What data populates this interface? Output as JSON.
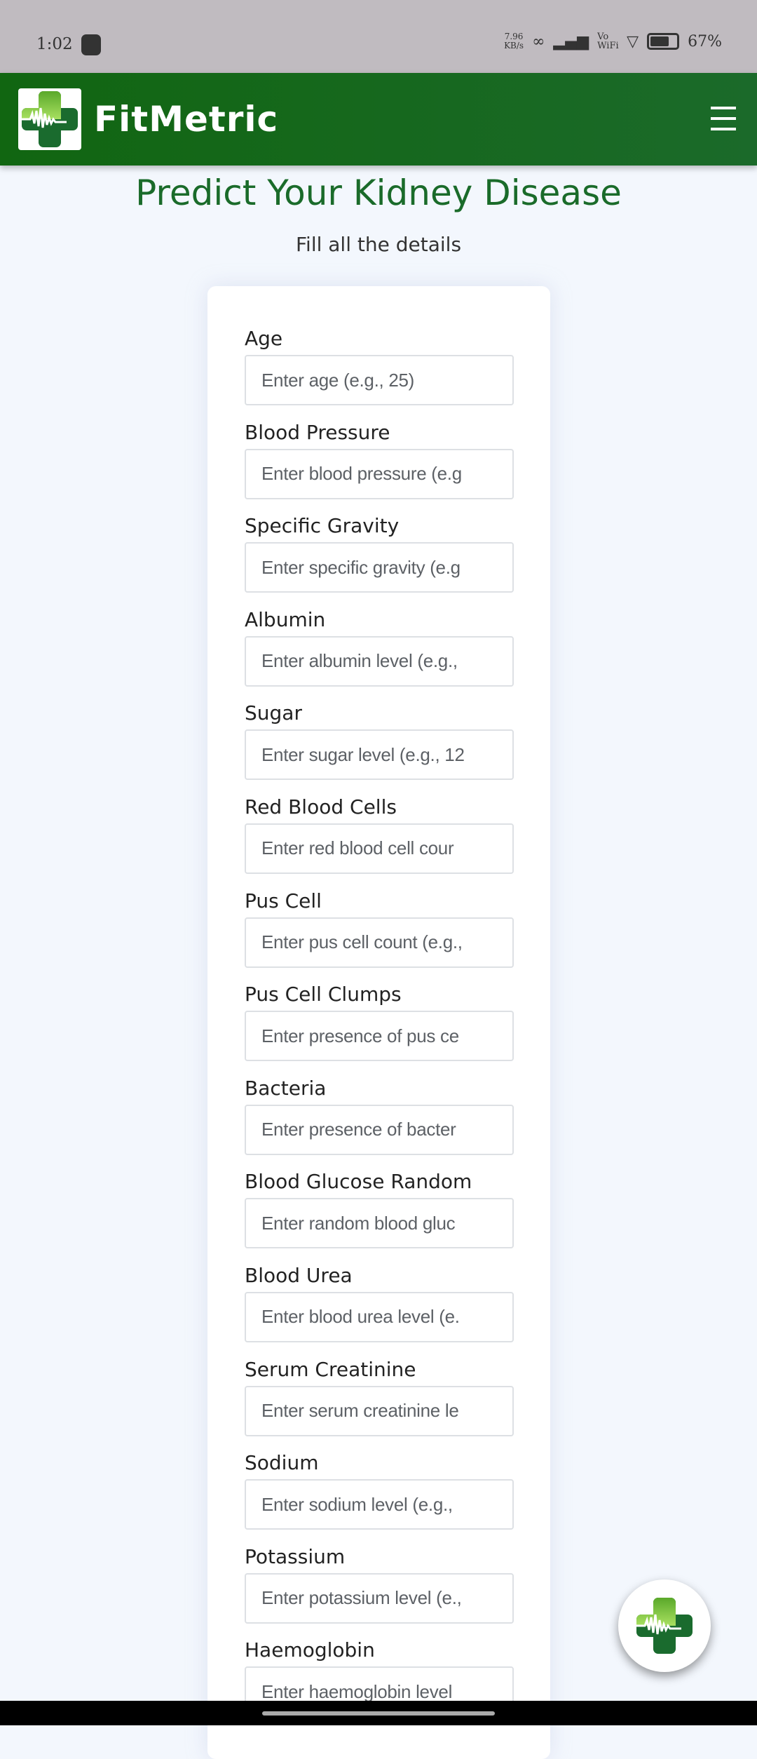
{
  "status_bar": {
    "time": "1:02",
    "net_speed": "7.96",
    "net_unit": "KB/s",
    "volte": "Vo WiFi",
    "battery": "67%"
  },
  "header": {
    "brand": "FitMetric",
    "menu_icon": "hamburger-icon",
    "brand_colors": [
      "#116611",
      "#1b6a2a"
    ]
  },
  "page": {
    "title": "Predict Your Kidney Disease",
    "subtitle": "Fill all the details"
  },
  "fields": [
    {
      "label": "Age",
      "placeholder": "Enter age (e.g., 25)"
    },
    {
      "label": "Blood Pressure",
      "placeholder": "Enter blood pressure (e.g"
    },
    {
      "label": "Specific Gravity",
      "placeholder": "Enter specific gravity (e.g"
    },
    {
      "label": "Albumin",
      "placeholder": "Enter albumin level (e.g.,"
    },
    {
      "label": "Sugar",
      "placeholder": "Enter sugar level (e.g., 12"
    },
    {
      "label": "Red Blood Cells",
      "placeholder": "Enter red blood cell cour"
    },
    {
      "label": "Pus Cell",
      "placeholder": "Enter pus cell count (e.g.,"
    },
    {
      "label": "Pus Cell Clumps",
      "placeholder": "Enter presence of pus ce"
    },
    {
      "label": "Bacteria",
      "placeholder": "Enter presence of bacter"
    },
    {
      "label": "Blood Glucose Random",
      "placeholder": "Enter random blood gluc"
    },
    {
      "label": "Blood Urea",
      "placeholder": "Enter blood urea level (e."
    },
    {
      "label": "Serum Creatinine",
      "placeholder": "Enter serum creatinine le"
    },
    {
      "label": "Sodium",
      "placeholder": "Enter sodium level (e.g.,"
    },
    {
      "label": "Potassium",
      "placeholder": "Enter potassium level (e.,"
    },
    {
      "label": "Haemoglobin",
      "placeholder": "Enter haemoglobin level"
    }
  ]
}
